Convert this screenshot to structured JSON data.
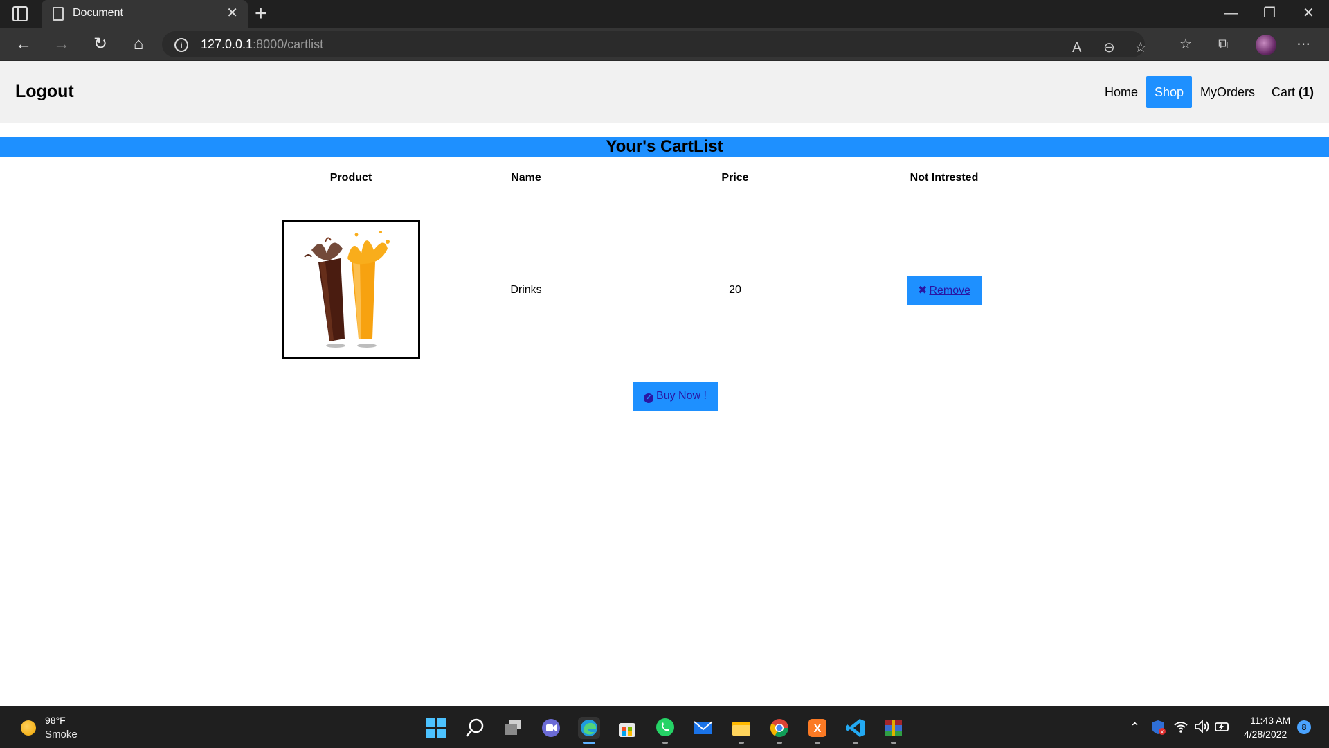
{
  "browser": {
    "tab_title": "Document",
    "url_host": "127.0.0.1",
    "url_path": ":8000/cartlist"
  },
  "navbar": {
    "brand": "Logout",
    "items": [
      {
        "label": "Home"
      },
      {
        "label": "Shop"
      },
      {
        "label": "MyOrders"
      },
      {
        "label": "Cart ",
        "count": "(1)"
      }
    ],
    "active_item": "Shop"
  },
  "cart": {
    "heading": "Your's CartList",
    "columns": [
      "Product",
      "Name",
      "Price",
      "Not Intrested"
    ],
    "rows": [
      {
        "image_icon": "drinks-product-image",
        "name": "Drinks",
        "price": "20",
        "remove_label": "Remove"
      }
    ],
    "buy_label": "Buy Now !"
  },
  "taskbar": {
    "weather_temp": "98°F",
    "weather_desc": "Smoke",
    "time": "11:43 AM",
    "date": "4/28/2022",
    "notification_count": "8"
  },
  "colors": {
    "accent": "#1e90ff",
    "navbar_bg": "#f1f1f1",
    "link": "#2a16a3"
  }
}
